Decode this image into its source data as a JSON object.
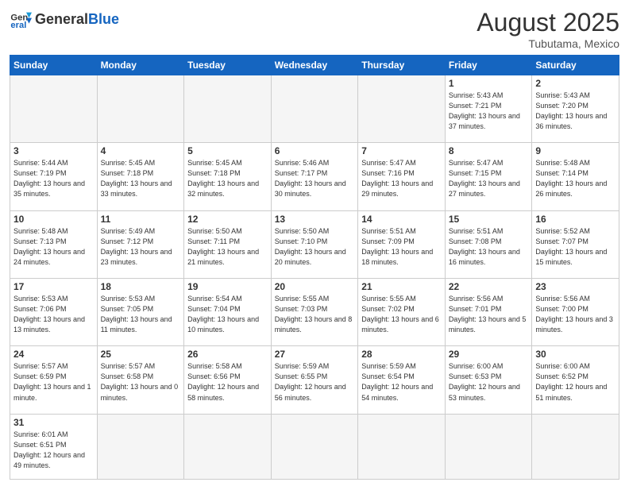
{
  "header": {
    "logo_general": "General",
    "logo_blue": "Blue",
    "month_title": "August 2025",
    "location": "Tubutama, Mexico"
  },
  "weekdays": [
    "Sunday",
    "Monday",
    "Tuesday",
    "Wednesday",
    "Thursday",
    "Friday",
    "Saturday"
  ],
  "weeks": [
    [
      {
        "day": "",
        "info": ""
      },
      {
        "day": "",
        "info": ""
      },
      {
        "day": "",
        "info": ""
      },
      {
        "day": "",
        "info": ""
      },
      {
        "day": "",
        "info": ""
      },
      {
        "day": "1",
        "info": "Sunrise: 5:43 AM\nSunset: 7:21 PM\nDaylight: 13 hours\nand 37 minutes."
      },
      {
        "day": "2",
        "info": "Sunrise: 5:43 AM\nSunset: 7:20 PM\nDaylight: 13 hours\nand 36 minutes."
      }
    ],
    [
      {
        "day": "3",
        "info": "Sunrise: 5:44 AM\nSunset: 7:19 PM\nDaylight: 13 hours\nand 35 minutes."
      },
      {
        "day": "4",
        "info": "Sunrise: 5:45 AM\nSunset: 7:18 PM\nDaylight: 13 hours\nand 33 minutes."
      },
      {
        "day": "5",
        "info": "Sunrise: 5:45 AM\nSunset: 7:18 PM\nDaylight: 13 hours\nand 32 minutes."
      },
      {
        "day": "6",
        "info": "Sunrise: 5:46 AM\nSunset: 7:17 PM\nDaylight: 13 hours\nand 30 minutes."
      },
      {
        "day": "7",
        "info": "Sunrise: 5:47 AM\nSunset: 7:16 PM\nDaylight: 13 hours\nand 29 minutes."
      },
      {
        "day": "8",
        "info": "Sunrise: 5:47 AM\nSunset: 7:15 PM\nDaylight: 13 hours\nand 27 minutes."
      },
      {
        "day": "9",
        "info": "Sunrise: 5:48 AM\nSunset: 7:14 PM\nDaylight: 13 hours\nand 26 minutes."
      }
    ],
    [
      {
        "day": "10",
        "info": "Sunrise: 5:48 AM\nSunset: 7:13 PM\nDaylight: 13 hours\nand 24 minutes."
      },
      {
        "day": "11",
        "info": "Sunrise: 5:49 AM\nSunset: 7:12 PM\nDaylight: 13 hours\nand 23 minutes."
      },
      {
        "day": "12",
        "info": "Sunrise: 5:50 AM\nSunset: 7:11 PM\nDaylight: 13 hours\nand 21 minutes."
      },
      {
        "day": "13",
        "info": "Sunrise: 5:50 AM\nSunset: 7:10 PM\nDaylight: 13 hours\nand 20 minutes."
      },
      {
        "day": "14",
        "info": "Sunrise: 5:51 AM\nSunset: 7:09 PM\nDaylight: 13 hours\nand 18 minutes."
      },
      {
        "day": "15",
        "info": "Sunrise: 5:51 AM\nSunset: 7:08 PM\nDaylight: 13 hours\nand 16 minutes."
      },
      {
        "day": "16",
        "info": "Sunrise: 5:52 AM\nSunset: 7:07 PM\nDaylight: 13 hours\nand 15 minutes."
      }
    ],
    [
      {
        "day": "17",
        "info": "Sunrise: 5:53 AM\nSunset: 7:06 PM\nDaylight: 13 hours\nand 13 minutes."
      },
      {
        "day": "18",
        "info": "Sunrise: 5:53 AM\nSunset: 7:05 PM\nDaylight: 13 hours\nand 11 minutes."
      },
      {
        "day": "19",
        "info": "Sunrise: 5:54 AM\nSunset: 7:04 PM\nDaylight: 13 hours\nand 10 minutes."
      },
      {
        "day": "20",
        "info": "Sunrise: 5:55 AM\nSunset: 7:03 PM\nDaylight: 13 hours\nand 8 minutes."
      },
      {
        "day": "21",
        "info": "Sunrise: 5:55 AM\nSunset: 7:02 PM\nDaylight: 13 hours\nand 6 minutes."
      },
      {
        "day": "22",
        "info": "Sunrise: 5:56 AM\nSunset: 7:01 PM\nDaylight: 13 hours\nand 5 minutes."
      },
      {
        "day": "23",
        "info": "Sunrise: 5:56 AM\nSunset: 7:00 PM\nDaylight: 13 hours\nand 3 minutes."
      }
    ],
    [
      {
        "day": "24",
        "info": "Sunrise: 5:57 AM\nSunset: 6:59 PM\nDaylight: 13 hours\nand 1 minute."
      },
      {
        "day": "25",
        "info": "Sunrise: 5:57 AM\nSunset: 6:58 PM\nDaylight: 13 hours\nand 0 minutes."
      },
      {
        "day": "26",
        "info": "Sunrise: 5:58 AM\nSunset: 6:56 PM\nDaylight: 12 hours\nand 58 minutes."
      },
      {
        "day": "27",
        "info": "Sunrise: 5:59 AM\nSunset: 6:55 PM\nDaylight: 12 hours\nand 56 minutes."
      },
      {
        "day": "28",
        "info": "Sunrise: 5:59 AM\nSunset: 6:54 PM\nDaylight: 12 hours\nand 54 minutes."
      },
      {
        "day": "29",
        "info": "Sunrise: 6:00 AM\nSunset: 6:53 PM\nDaylight: 12 hours\nand 53 minutes."
      },
      {
        "day": "30",
        "info": "Sunrise: 6:00 AM\nSunset: 6:52 PM\nDaylight: 12 hours\nand 51 minutes."
      }
    ],
    [
      {
        "day": "31",
        "info": "Sunrise: 6:01 AM\nSunset: 6:51 PM\nDaylight: 12 hours\nand 49 minutes."
      },
      {
        "day": "",
        "info": ""
      },
      {
        "day": "",
        "info": ""
      },
      {
        "day": "",
        "info": ""
      },
      {
        "day": "",
        "info": ""
      },
      {
        "day": "",
        "info": ""
      },
      {
        "day": "",
        "info": ""
      }
    ]
  ]
}
